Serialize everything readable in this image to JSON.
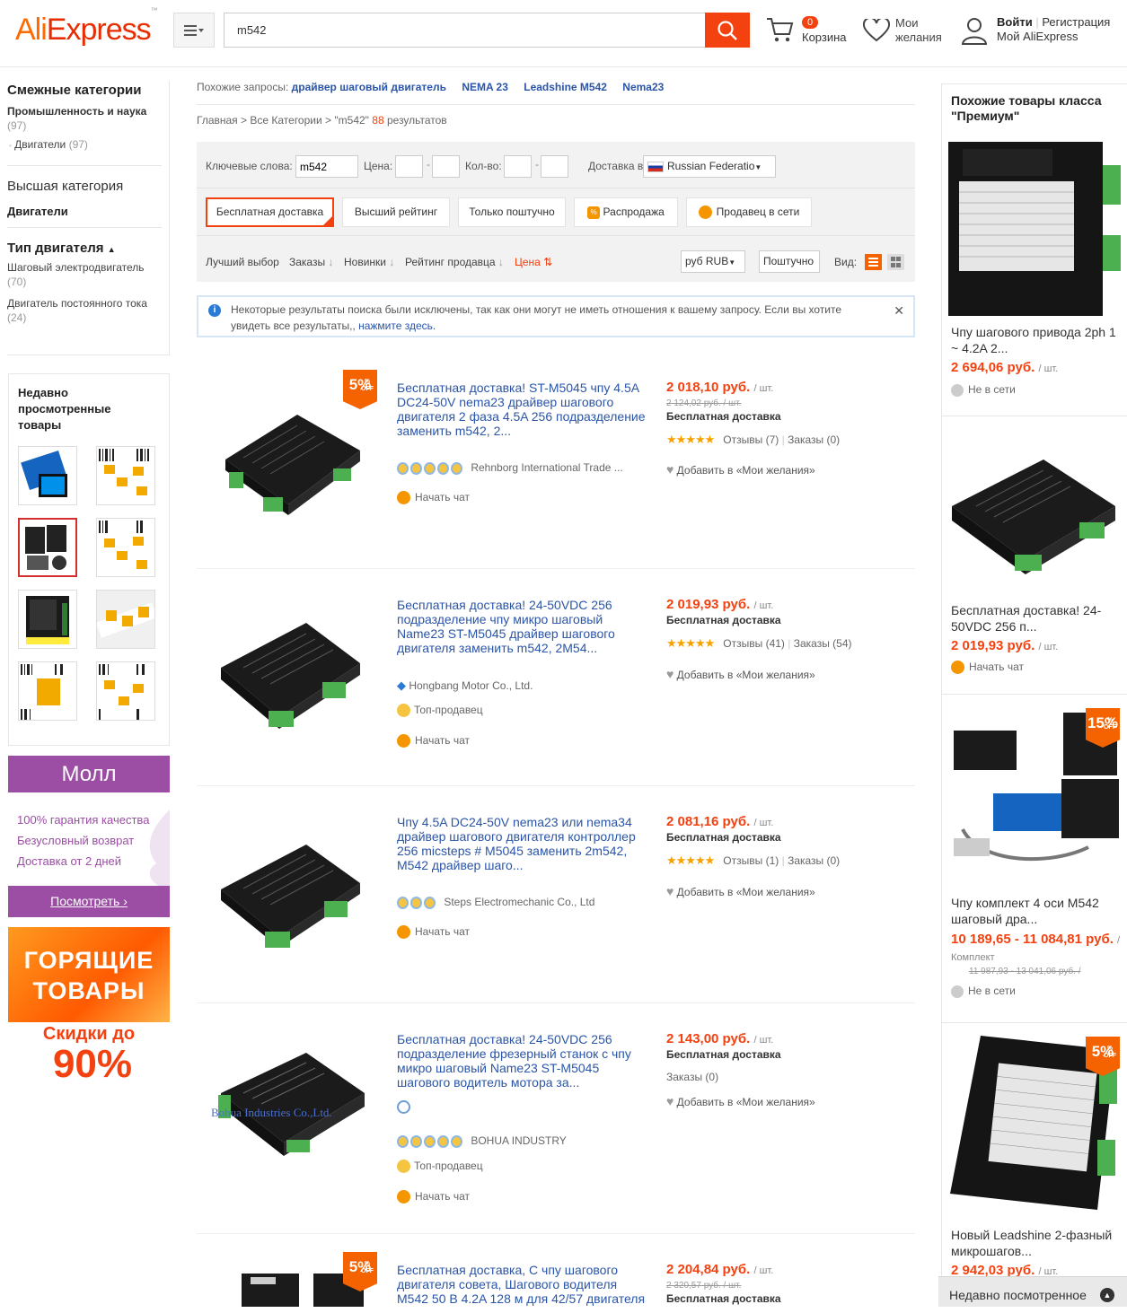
{
  "header": {
    "logo": "AliExpress",
    "logo_tm": "™",
    "search_value": "m542",
    "cart_count": "0",
    "cart_label": "Корзина",
    "wishlist_line1": "Мои",
    "wishlist_line2": "желания",
    "signin": "Войти",
    "register": "Регистрация",
    "my_account": "Мой AliExpress"
  },
  "left": {
    "related_title": "Смежные категории",
    "related_cat": "Промышленность и наука",
    "related_cat_count": "(97)",
    "related_sub": "Двигатели",
    "related_sub_count": "(97)",
    "top_title": "Высшая категория",
    "top_cat": "Двигатели",
    "motor_type_title": "Тип двигателя",
    "motor_type_1": "Шаговый электродвигатель",
    "motor_type_1_count": "(70)",
    "motor_type_2": "Двигатель постоянного тока",
    "motor_type_2_count": "(24)",
    "recent_title": "Недавно просмотренные товары",
    "mall_title": "Молл",
    "mall_lines": [
      "100% гарантия качества",
      "Безусловный возврат",
      "Доставка от 2 дней"
    ],
    "mall_button": "Посмотреть ›",
    "hot_title_1": "ГОРЯЩИЕ",
    "hot_title_2": "ТОВАРЫ",
    "hot_sub": "Скидки до",
    "hot_percent": "90%"
  },
  "center": {
    "similar_label": "Похожие запросы:",
    "similar": [
      "драйвер шаговый двигатель",
      "NEMA 23",
      "Leadshine M542",
      "Nema23"
    ],
    "breadcrumb_home": "Главная",
    "breadcrumb_all": "Все Категории",
    "breadcrumb_query": "\"m542\"",
    "breadcrumb_count": "88",
    "breadcrumb_results": "результатов",
    "kw_label": "Ключевые слова:",
    "kw_value": "m542",
    "price_label": "Цена:",
    "qty_label": "Кол-во:",
    "ship_label": "Доставка в",
    "ship_country": "Russian Federatio",
    "filters": [
      "Бесплатная доставка",
      "Высший рейтинг",
      "Только поштучно",
      "Распродажа",
      "Продавец в сети"
    ],
    "sorts": [
      "Лучший выбор",
      "Заказы",
      "Новинки",
      "Рейтинг продавца",
      "Цена"
    ],
    "currency": "руб RUB",
    "unit_select": "Поштучно",
    "view_label": "Вид:",
    "notice_text": "Некоторые результаты поиска были исключены, так как они могут не иметь отношения к вашему запросу. Если вы хотите увидеть все результаты,,",
    "notice_link": "нажмите здесь."
  },
  "items": [
    {
      "title": "Бесплатная доставка! ST-M5045 чпу 4.5A DC24-50V nema23 драйвер шагового двигателя 2 фаза 4.5A 256 подразделение заменить m542, 2...",
      "price": "2 018,10 руб.",
      "unit": "/ шт.",
      "old_price": "2 124,02 руб. / шт.",
      "shipping": "Бесплатная доставка",
      "reviews": "Отзывы (7)",
      "orders": "Заказы (0)",
      "wish": "Добавить в «Мои желания»",
      "seller": "Rehnborg International Trade ...",
      "chat": "Начать чат",
      "discount": "5"
    },
    {
      "title": "Бесплатная доставка! 24-50VDC 256 подразделение чпу микро шаговый Name23 ST-M5045 драйвер шагового двигателя заменить m542, 2M54...",
      "price": "2 019,93 руб.",
      "unit": "/ шт.",
      "shipping": "Бесплатная доставка",
      "reviews": "Отзывы (41)",
      "orders": "Заказы (54)",
      "wish": "Добавить в «Мои желания»",
      "seller": "Hongbang Motor Co., Ltd.",
      "top": "Топ-продавец",
      "chat": "Начать чат"
    },
    {
      "title": "Чпу 4.5A DC24-50V nema23 или nema34 драйвер шагового двигателя контроллер 256 micsteps # M5045 заменить 2m542, M542 драйвер шаго...",
      "price": "2 081,16 руб.",
      "unit": "/ шт.",
      "shipping": "Бесплатная доставка",
      "reviews": "Отзывы (1)",
      "orders": "Заказы (0)",
      "wish": "Добавить в «Мои желания»",
      "seller": "Steps Electromechanic Co., Ltd",
      "chat": "Начать чат"
    },
    {
      "title": "Бесплатная доставка! 24-50VDC 256 подразделение фрезерный станок с чпу микро шаговый Name23 ST-M5045 шагового водитель мотора за...",
      "price": "2 143,00 руб.",
      "unit": "/ шт.",
      "shipping": "Бесплатная доставка",
      "orders": "Заказы (0)",
      "wish": "Добавить в «Мои желания»",
      "seller": "BOHUA INDUSTRY",
      "top": "Топ-продавец",
      "chat": "Начать чат",
      "watermark": "Bohua Industries Co.,Ltd."
    },
    {
      "title": "Бесплатная доставка, С чпу шагового двигателя совета, Шагового водителя M542 50 В 4.2A 128 м для 42/57 двигателя",
      "price": "2 204,84 руб.",
      "unit": "/ шт.",
      "old_price": "2 320,57 руб. / шт.",
      "shipping": "Бесплатная доставка",
      "discount": "5"
    }
  ],
  "right": {
    "title": "Похожие товары класса \"Премиум\"",
    "cards": [
      {
        "title": "Чпу шагового привода 2ph 1 ~ 4.2A 2...",
        "price": "2 694,06 руб.",
        "unit": "/ шт.",
        "status": "Не в сети"
      },
      {
        "title": "Бесплатная доставка! 24-50VDC 256 п...",
        "price": "2 019,93 руб.",
        "unit": "/ шт.",
        "status": "Начать чат"
      },
      {
        "title": "Чпу комплект 4 оси M542 шаговый дра...",
        "price": "10 189,65 - 11 084,81 руб.",
        "unit": "/ Комплект",
        "old_price": "11 987,93 - 13 041,06 руб. /",
        "status": "Не в сети",
        "discount": "15"
      },
      {
        "title": "Новый Leadshine 2-фазный микрошагов...",
        "price": "2 942,03 руб.",
        "unit": "/ шт.",
        "discount": "5"
      }
    ]
  },
  "footer": {
    "recent_bar": "Недавно посмотренное"
  },
  "colors": {
    "accent": "#f44110",
    "link": "#2a55a8",
    "mall": "#9b4ea4"
  }
}
